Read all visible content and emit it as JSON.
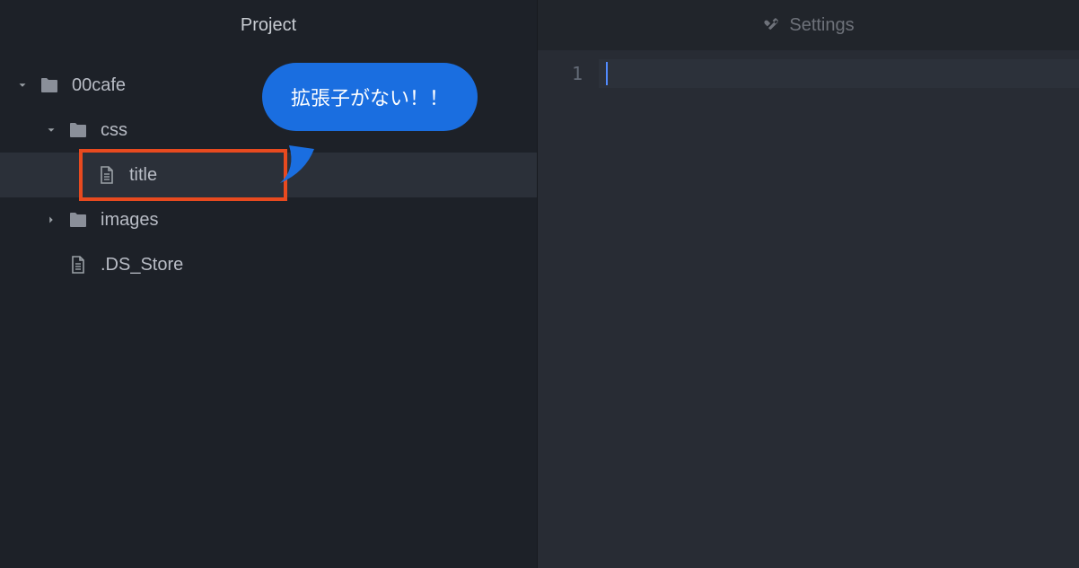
{
  "sidebar": {
    "title": "Project",
    "tree": {
      "root": {
        "name": "00cafe",
        "expanded": true
      },
      "css_folder": {
        "name": "css",
        "expanded": true
      },
      "title_file": {
        "name": "title"
      },
      "images_folder": {
        "name": "images",
        "expanded": false
      },
      "ds_store_file": {
        "name": ".DS_Store"
      }
    }
  },
  "editor": {
    "tab_label": "Settings",
    "line_number": "1"
  },
  "annotation": {
    "bubble_text": "拡張子がない！！"
  }
}
